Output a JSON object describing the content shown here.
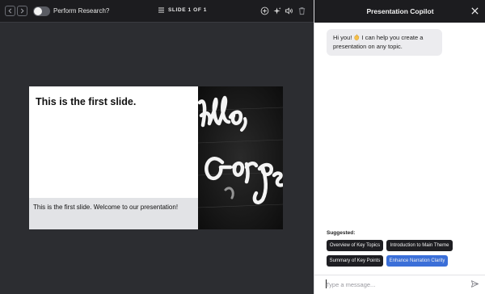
{
  "toolbar": {
    "prev_icon": "chevron-left-icon",
    "next_icon": "chevron-right-icon",
    "research_toggle_label": "Perform Research?",
    "research_toggle_on": false,
    "slide_indicator": "SLIDE 1 OF 1",
    "tools": [
      "add-slide-icon",
      "sparkle-icon",
      "speaker-icon",
      "trash-icon"
    ]
  },
  "slide": {
    "title": "This is the first slide.",
    "caption": "This is the first slide. Welcome to our presentation!",
    "image_text": "Hello, Gorgeous"
  },
  "copilot": {
    "title": "Presentation Copilot",
    "greeting": "Hi you! 👋 I can help you create a presentation on any topic.",
    "greeting_before": "Hi you!",
    "greeting_after": "I can help you create a presentation on any topic.",
    "suggested_label": "Suggested:",
    "suggestions": [
      "Overview of Key Topics",
      "Introduction to Main Theme",
      "Summary of Key Points",
      "Enhance Narration Clarity"
    ],
    "input_placeholder": "Type a message..."
  },
  "colors": {
    "dark_bar": "#1c1c1f",
    "canvas_bg": "#2c2d31",
    "chip": "#1e1e22",
    "accent": "#3b6fd8"
  }
}
